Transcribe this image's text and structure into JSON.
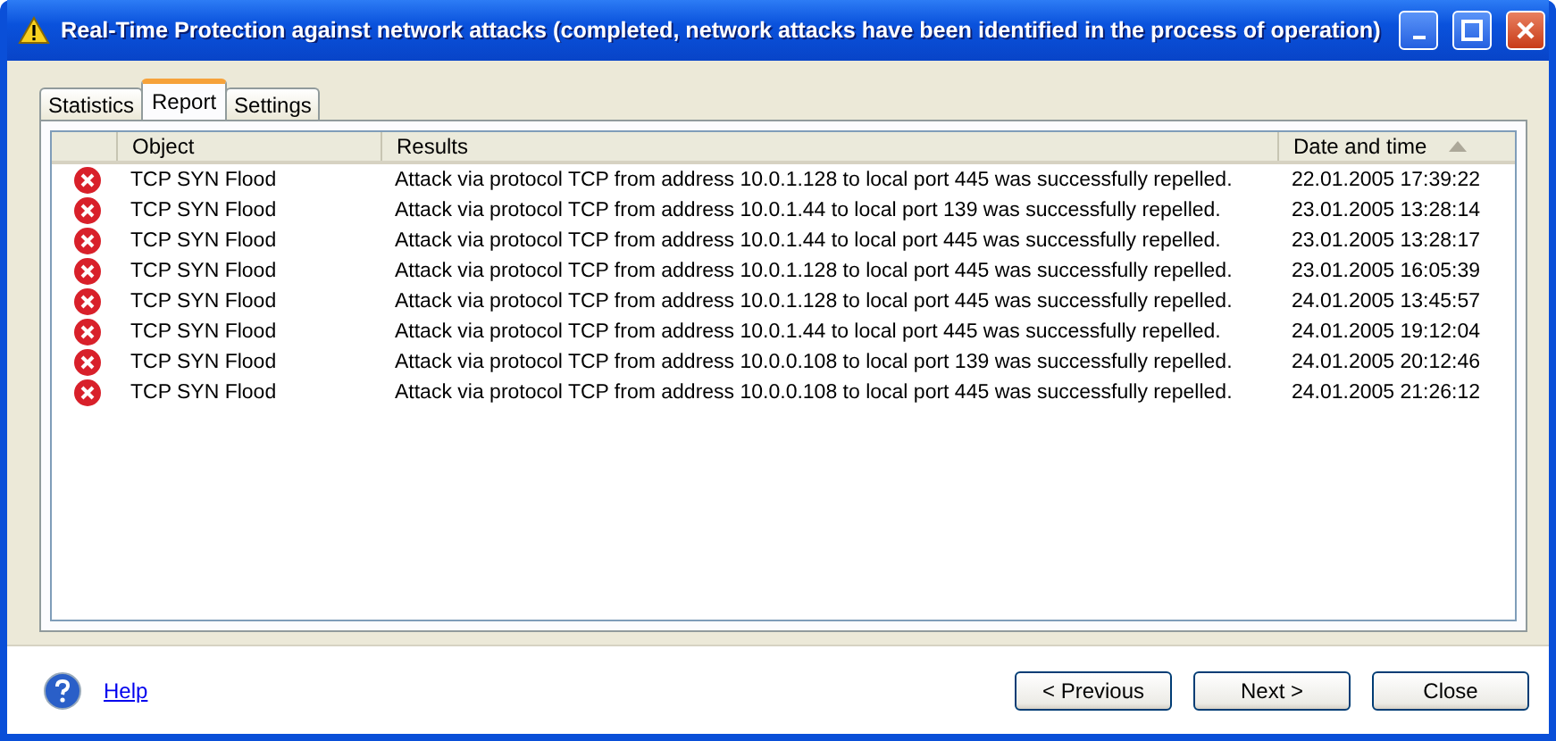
{
  "window": {
    "title": "Real-Time Protection against network attacks (completed, network attacks have been identified in the process of operation)"
  },
  "tabs": [
    {
      "label": "Statistics",
      "selected": false
    },
    {
      "label": "Report",
      "selected": true
    },
    {
      "label": "Settings",
      "selected": false
    }
  ],
  "table": {
    "columns": [
      {
        "label": "Object",
        "sorted": false
      },
      {
        "label": "Results",
        "sorted": false
      },
      {
        "label": "Date and time",
        "sorted": true
      }
    ],
    "rows": [
      {
        "kind": "error",
        "object": "TCP SYN Flood",
        "result": "Attack via protocol TCP from address 10.0.1.128 to local port 445 was successfully repelled.",
        "date": "22.01.2005 17:39:22"
      },
      {
        "kind": "error",
        "object": "TCP SYN Flood",
        "result": "Attack via protocol TCP from address 10.0.1.44 to local port 139 was successfully repelled.",
        "date": "23.01.2005 13:28:14"
      },
      {
        "kind": "error",
        "object": "TCP SYN Flood",
        "result": "Attack via protocol TCP from address 10.0.1.44 to local port 445 was successfully repelled.",
        "date": "23.01.2005 13:28:17"
      },
      {
        "kind": "error",
        "object": "TCP SYN Flood",
        "result": "Attack via protocol TCP from address 10.0.1.128 to local port 445 was successfully repelled.",
        "date": "23.01.2005 16:05:39"
      },
      {
        "kind": "error",
        "object": "TCP SYN Flood",
        "result": "Attack via protocol TCP from address 10.0.1.128 to local port 445 was successfully repelled.",
        "date": "24.01.2005 13:45:57"
      },
      {
        "kind": "error",
        "object": "TCP SYN Flood",
        "result": "Attack via protocol TCP from address 10.0.1.44 to local port 445 was successfully repelled.",
        "date": "24.01.2005 19:12:04"
      },
      {
        "kind": "error",
        "object": "TCP SYN Flood",
        "result": "Attack via protocol TCP from address 10.0.0.108 to local port 139 was successfully repelled.",
        "date": "24.01.2005 20:12:46"
      },
      {
        "kind": "error",
        "object": "TCP SYN Flood",
        "result": "Attack via protocol TCP from address 10.0.0.108 to local port 445 was successfully repelled.",
        "date": "24.01.2005 21:26:12"
      }
    ]
  },
  "footer": {
    "help": "Help",
    "buttons": [
      "< Previous",
      "Next >",
      "Close"
    ]
  }
}
